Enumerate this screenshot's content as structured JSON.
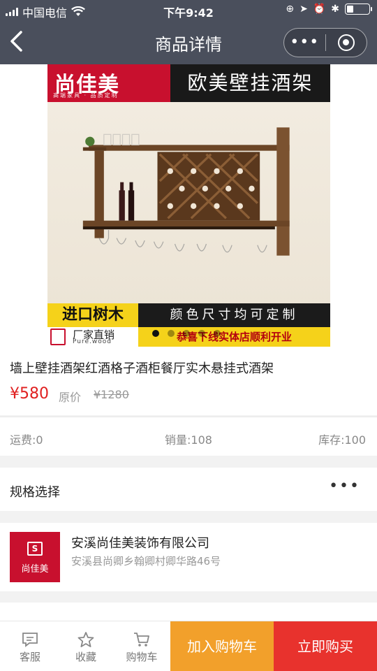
{
  "status_bar": {
    "carrier": "中国电信",
    "time": "下午9:42",
    "battery_level": 0.3
  },
  "nav": {
    "title": "商品详情"
  },
  "banner": {
    "brand_name": "尚佳美",
    "brand_slogan": "高端家具 · 品质定制",
    "headline": "欧美壁挂酒架",
    "tag_import": "进口树木",
    "tag_custom": "颜色尺寸均可定制",
    "factory_title": "厂家直销",
    "factory_sub": "Pure.wood",
    "opening": "恭喜下线实体店顺利开业",
    "slide_count": 5,
    "active_slide": 1
  },
  "product": {
    "title": "墙上壁挂酒架红酒格子酒柜餐厅实木悬挂式酒架",
    "price": "¥580",
    "original_label": "原价",
    "original_price": "¥1280"
  },
  "stats": {
    "shipping": "运费:0",
    "sales": "销量:108",
    "stock": "库存:100"
  },
  "spec": {
    "label": "规格选择",
    "more": "•••"
  },
  "shop": {
    "logo_text": "尚佳美",
    "name": "安溪尚佳美装饰有限公司",
    "address": "安溪县尚卿乡翰卿村卿华路46号"
  },
  "bottom_bar": {
    "service": "客服",
    "favorite": "收藏",
    "cart": "购物车",
    "add_to_cart": "加入购物车",
    "buy_now": "立即购买"
  },
  "colors": {
    "nav_bg": "#4a4f5c",
    "price_red": "#e02020",
    "brand_red": "#c8102e",
    "cart_orange": "#f2a02b",
    "buy_red": "#e8322d"
  }
}
